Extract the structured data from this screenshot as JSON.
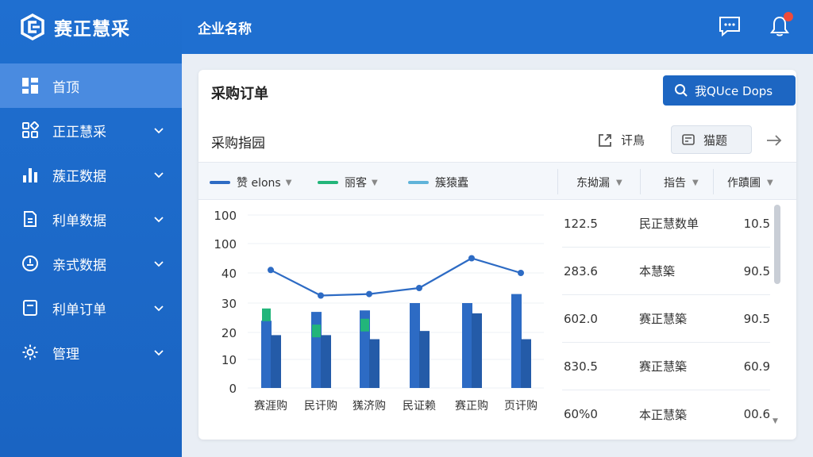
{
  "app": {
    "name": "赛正慧采",
    "company": "企业名称"
  },
  "sidebar": {
    "items": [
      {
        "label": "首顶",
        "icon": "dashboard-icon",
        "active": true,
        "expandable": false
      },
      {
        "label": "正正慧采",
        "icon": "grid-icon",
        "active": false,
        "expandable": true
      },
      {
        "label": "蔟正数据",
        "icon": "bar-chart-icon",
        "active": false,
        "expandable": true
      },
      {
        "label": "利单数据",
        "icon": "document-icon",
        "active": false,
        "expandable": true
      },
      {
        "label": "亲式数据",
        "icon": "gauge-icon",
        "active": false,
        "expandable": true
      },
      {
        "label": "利单订单",
        "icon": "file-icon",
        "active": false,
        "expandable": true
      },
      {
        "label": "管理",
        "icon": "gear-icon",
        "active": false,
        "expandable": true
      }
    ]
  },
  "header": {
    "message_icon": "message-icon",
    "bell_icon": "bell-icon"
  },
  "card": {
    "title": "采购订单",
    "search_button": "我QUce Dops",
    "subtitle": "采购指园",
    "export_label": "讦鳥",
    "filter_label": "猫题",
    "legend": [
      {
        "label": "赞 elons",
        "color": "#2d6bc4"
      },
      {
        "label": "丽客",
        "color": "#22b57a"
      },
      {
        "label": "簇猿蠹",
        "color": "#5fb3d9"
      }
    ],
    "columns": [
      "东拗漏",
      "指告",
      "作蹟圃"
    ]
  },
  "chart_data": {
    "type": "bar",
    "y_ticks": [
      "100",
      "100",
      "40",
      "30",
      "20",
      "10",
      "0"
    ],
    "categories": [
      "赛涯购",
      "民讦购",
      "獇济购",
      "民证赖",
      "赛正购",
      "页讦购"
    ],
    "series": [
      {
        "type": "bar",
        "color": "#2d6bc4",
        "values": [
          24,
          27,
          27.5,
          30,
          30,
          33
        ]
      },
      {
        "type": "bar",
        "color": "#245ba8",
        "values": [
          19,
          19,
          17.5,
          20.5,
          26.5,
          17.5
        ]
      },
      {
        "type": "bar",
        "color": "#22b57a",
        "values": [
          26,
          20.5,
          22.5,
          null,
          null,
          null
        ]
      },
      {
        "type": "line",
        "color": "#2d6bc4",
        "values": [
          41,
          32.5,
          33,
          35,
          45,
          40
        ]
      }
    ]
  },
  "table": {
    "rows": [
      [
        "122.5",
        "民正慧数单",
        "10.5"
      ],
      [
        "283.6",
        "本慧築",
        "90.5"
      ],
      [
        "602.0",
        "赛正慧築",
        "90.5"
      ],
      [
        "830.5",
        "赛正慧築",
        "60.9"
      ],
      [
        "60%0",
        "本正慧築",
        "00.6"
      ]
    ]
  }
}
